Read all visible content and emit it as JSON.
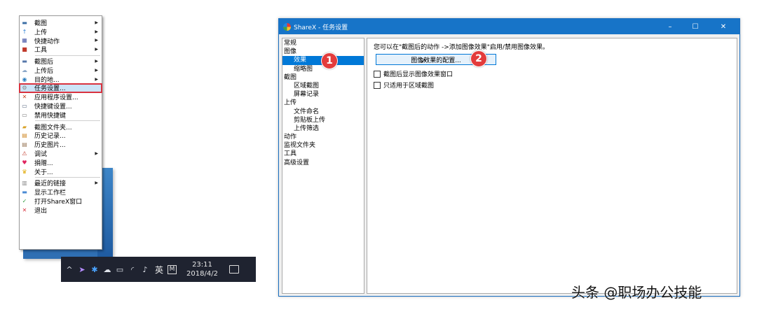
{
  "context_menu": {
    "groups": [
      [
        {
          "label": "截图",
          "icon": "screen-icon",
          "glyph": "▬",
          "color": "#3b6ea5",
          "submenu": true
        },
        {
          "label": "上传",
          "icon": "upload-arrow-icon",
          "glyph": "↑",
          "color": "#2a7fd4",
          "submenu": true
        },
        {
          "label": "快捷动作",
          "icon": "grid-icon",
          "glyph": "▦",
          "color": "#4a5aa8",
          "submenu": true
        },
        {
          "label": "工具",
          "icon": "toolbox-icon",
          "glyph": "■",
          "color": "#c0392b",
          "submenu": true
        }
      ],
      [
        {
          "label": "截图后",
          "icon": "image-after-icon",
          "glyph": "▬",
          "color": "#5577aa",
          "submenu": true
        },
        {
          "label": "上传后",
          "icon": "cloud-icon",
          "glyph": "☁",
          "color": "#8aa6c8",
          "submenu": true
        },
        {
          "label": "目的地...",
          "icon": "globe-icon",
          "glyph": "◉",
          "color": "#2f7fbf",
          "submenu": true
        },
        {
          "label": "任务设置...",
          "icon": "gear-icon",
          "glyph": "⚙",
          "color": "#888888",
          "submenu": false,
          "selected": true
        },
        {
          "label": "应用程序设置...",
          "icon": "wrench-icon",
          "glyph": "✕",
          "color": "#c44a2a",
          "submenu": false
        },
        {
          "label": "快捷键设置...",
          "icon": "keyboard-icon",
          "glyph": "▭",
          "color": "#5a6a80",
          "submenu": false
        },
        {
          "label": "禁用快捷键",
          "icon": "keyboard-disabled-icon",
          "glyph": "▭",
          "color": "#7a7a7a",
          "submenu": false
        }
      ],
      [
        {
          "label": "截图文件夹...",
          "icon": "folder-icon",
          "glyph": "▰",
          "color": "#d9a227",
          "submenu": false
        },
        {
          "label": "历史记录...",
          "icon": "history-icon",
          "glyph": "▤",
          "color": "#d08a2a",
          "submenu": false
        },
        {
          "label": "历史图片...",
          "icon": "image-history-icon",
          "glyph": "▤",
          "color": "#9a7a5a",
          "submenu": false
        },
        {
          "label": "调试",
          "icon": "bug-icon",
          "glyph": "⚠",
          "color": "#c0392b",
          "submenu": true
        },
        {
          "label": "捐赠...",
          "icon": "heart-icon",
          "glyph": "♥",
          "color": "#e0245e",
          "submenu": false
        },
        {
          "label": "关于...",
          "icon": "crown-icon",
          "glyph": "♛",
          "color": "#e0a800",
          "submenu": false
        }
      ],
      [
        {
          "label": "最近的链接",
          "icon": "clipboard-icon",
          "glyph": "▥",
          "color": "#8a8a8a",
          "submenu": true
        },
        {
          "label": "显示工作栏",
          "icon": "taskbar-icon",
          "glyph": "▬",
          "color": "#4a8ad4",
          "submenu": false
        },
        {
          "label": "打开ShareX窗口",
          "icon": "check-icon",
          "glyph": "✓",
          "color": "#2e9b3e",
          "submenu": false
        },
        {
          "label": "退出",
          "icon": "exit-icon",
          "glyph": "✕",
          "color": "#d9333f",
          "submenu": false
        }
      ]
    ]
  },
  "taskbar": {
    "ime": "英",
    "ime_mode": "M",
    "time": "23:11",
    "date": "2018/4/2"
  },
  "window": {
    "title": "ShareX - 任务设置",
    "controls": {
      "minimize": "–",
      "maximize": "☐",
      "close": "✕"
    },
    "nav": [
      {
        "label": "常规",
        "level": 0
      },
      {
        "label": "图像",
        "level": 0
      },
      {
        "label": "效果",
        "level": 1,
        "selected": true
      },
      {
        "label": "缩略图",
        "level": 1
      },
      {
        "label": "截图",
        "level": 0
      },
      {
        "label": "区域截图",
        "level": 1
      },
      {
        "label": "屏幕记录",
        "level": 1
      },
      {
        "label": "上传",
        "level": 0
      },
      {
        "label": "文件命名",
        "level": 1
      },
      {
        "label": "剪贴板上传",
        "level": 1
      },
      {
        "label": "上传筛选",
        "level": 1
      },
      {
        "label": "动作",
        "level": 0
      },
      {
        "label": "监视文件夹",
        "level": 0
      },
      {
        "label": "工具",
        "level": 0
      },
      {
        "label": "高级设置",
        "level": 0
      }
    ],
    "content": {
      "hint": "您可以在\"截图后的动作 ->添加图像效果\"启用/禁用图像效果。",
      "config_button": "图像效果的配置...",
      "checkbox_show_window": "截图后显示图像效果窗口",
      "checkbox_region_only": "只适用于区域截图"
    }
  },
  "annotations": {
    "badge1": "1",
    "badge2": "2"
  },
  "watermark": "头条 @职场办公技能"
}
